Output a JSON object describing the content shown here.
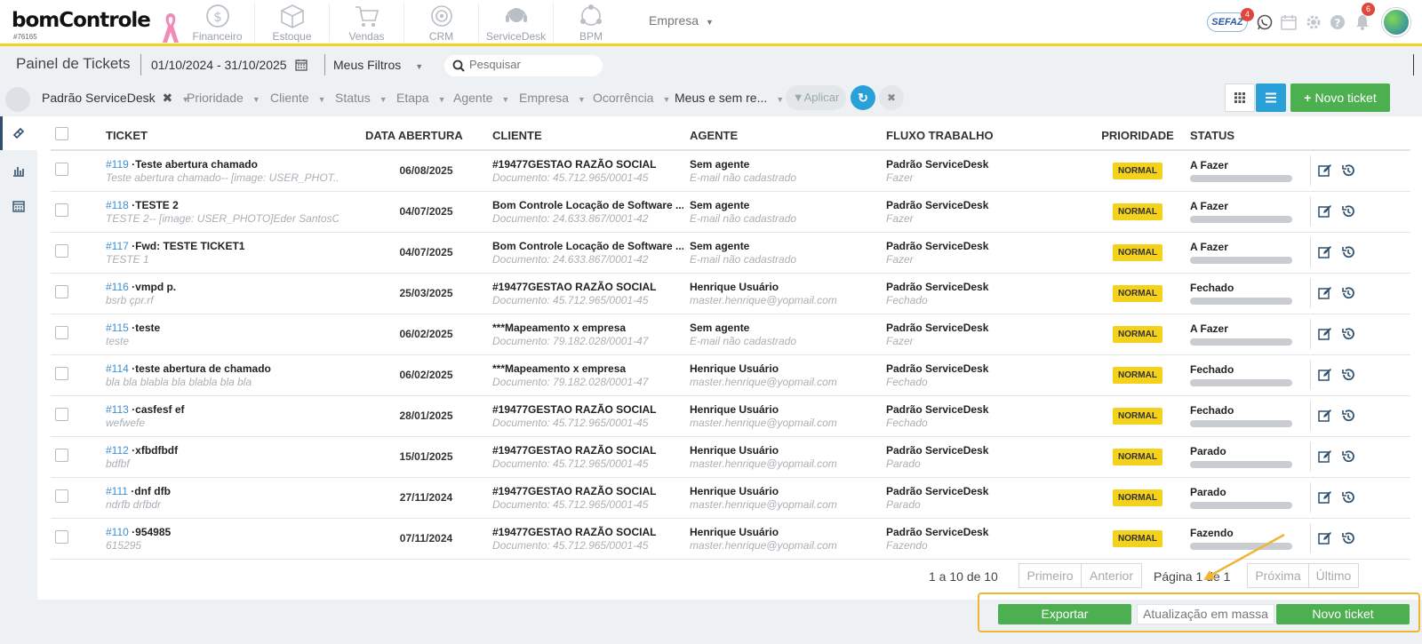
{
  "app": {
    "logo": "bomControle",
    "account_code": "#76165"
  },
  "modules": [
    "Financeiro",
    "Estoque",
    "Vendas",
    "CRM",
    "ServiceDesk",
    "BPM"
  ],
  "company_menu": "Empresa",
  "header_icons": {
    "sefaz": "SEFAZ",
    "sefaz_badge": "4",
    "notif_badge": "6"
  },
  "page": {
    "title": "Painel de Tickets",
    "date_range": "01/10/2024 - 31/10/2025",
    "filters_label": "Meus Filtros",
    "search_placeholder": "Pesquisar"
  },
  "filters": {
    "workflow": "Padrão ServiceDesk",
    "prioridade": "Prioridade",
    "cliente": "Cliente",
    "status": "Status",
    "etapa": "Etapa",
    "agente": "Agente",
    "empresa": "Empresa",
    "ocorrencia": "Ocorrência",
    "scope": "Meus e sem re...",
    "apply": "Aplicar",
    "new_ticket": "Novo ticket"
  },
  "table": {
    "headers": [
      "TICKET",
      "DATA ABERTURA",
      "CLIENTE",
      "AGENTE",
      "FLUXO TRABALHO",
      "PRIORIDADE",
      "STATUS"
    ],
    "rows": [
      {
        "num": "#119",
        "title": " ·Teste abertura chamado",
        "desc": "Teste abertura chamado-- [image: USER_PHOT...",
        "date": "06/08/2025",
        "client": "#19477GESTAO RAZÃO SOCIAL",
        "doc": "Documento: 45.712.965/0001-45",
        "agent": "Sem agente",
        "agent_sub": "E-mail não cadastrado",
        "flow": "Padrão ServiceDesk",
        "stage": "Fazer",
        "priority": "NORMAL",
        "status": "A Fazer"
      },
      {
        "num": "#118",
        "title": " ·TESTE 2",
        "desc": "TESTE 2-- [image: USER_PHOTO]Eder SantosCo...",
        "date": "04/07/2025",
        "client": "Bom Controle Locação de Software ...",
        "doc": "Documento: 24.633.867/0001-42",
        "agent": "Sem agente",
        "agent_sub": "E-mail não cadastrado",
        "flow": "Padrão ServiceDesk",
        "stage": "Fazer",
        "priority": "NORMAL",
        "status": "A Fazer"
      },
      {
        "num": "#117",
        "title": " ·Fwd: TESTE TICKET1",
        "desc": "TESTE 1",
        "date": "04/07/2025",
        "client": "Bom Controle Locação de Software ...",
        "doc": "Documento: 24.633.867/0001-42",
        "agent": "Sem agente",
        "agent_sub": "E-mail não cadastrado",
        "flow": "Padrão ServiceDesk",
        "stage": "Fazer",
        "priority": "NORMAL",
        "status": "A Fazer"
      },
      {
        "num": "#116",
        "title": " ·vmpd p.",
        "desc": "bsrb çpr.rf",
        "date": "25/03/2025",
        "client": "#19477GESTAO RAZÃO SOCIAL",
        "doc": "Documento: 45.712.965/0001-45",
        "agent": "Henrique Usuário",
        "agent_sub": "master.henrique@yopmail.com",
        "flow": "Padrão ServiceDesk",
        "stage": "Fechado",
        "priority": "NORMAL",
        "status": "Fechado"
      },
      {
        "num": "#115",
        "title": " ·teste",
        "desc": "teste",
        "date": "06/02/2025",
        "client": "***Mapeamento x empresa",
        "doc": "Documento: 79.182.028/0001-47",
        "agent": "Sem agente",
        "agent_sub": "E-mail não cadastrado",
        "flow": "Padrão ServiceDesk",
        "stage": "Fazer",
        "priority": "NORMAL",
        "status": "A Fazer"
      },
      {
        "num": "#114",
        "title": " ·teste abertura de chamado",
        "desc": "bla bla blabla bla blabla bla bla",
        "date": "06/02/2025",
        "client": "***Mapeamento x empresa",
        "doc": "Documento: 79.182.028/0001-47",
        "agent": "Henrique Usuário",
        "agent_sub": "master.henrique@yopmail.com",
        "flow": "Padrão ServiceDesk",
        "stage": "Fechado",
        "priority": "NORMAL",
        "status": "Fechado"
      },
      {
        "num": "#113",
        "title": " ·casfesf ef",
        "desc": "wefwefe",
        "date": "28/01/2025",
        "client": "#19477GESTAO RAZÃO SOCIAL",
        "doc": "Documento: 45.712.965/0001-45",
        "agent": "Henrique Usuário",
        "agent_sub": "master.henrique@yopmail.com",
        "flow": "Padrão ServiceDesk",
        "stage": "Fechado",
        "priority": "NORMAL",
        "status": "Fechado"
      },
      {
        "num": "#112",
        "title": " ·xfbdfbdf",
        "desc": "bdfbf",
        "date": "15/01/2025",
        "client": "#19477GESTAO RAZÃO SOCIAL",
        "doc": "Documento: 45.712.965/0001-45",
        "agent": "Henrique Usuário",
        "agent_sub": "master.henrique@yopmail.com",
        "flow": "Padrão ServiceDesk",
        "stage": "Parado",
        "priority": "NORMAL",
        "status": "Parado"
      },
      {
        "num": "#111",
        "title": " ·dnf dfb",
        "desc": "ndrfb drfbdr",
        "date": "27/11/2024",
        "client": "#19477GESTAO RAZÃO SOCIAL",
        "doc": "Documento: 45.712.965/0001-45",
        "agent": "Henrique Usuário",
        "agent_sub": "master.henrique@yopmail.com",
        "flow": "Padrão ServiceDesk",
        "stage": "Parado",
        "priority": "NORMAL",
        "status": "Parado"
      },
      {
        "num": "#110",
        "title": " ·954985",
        "desc": "615295",
        "date": "07/11/2024",
        "client": "#19477GESTAO RAZÃO SOCIAL",
        "doc": "Documento: 45.712.965/0001-45",
        "agent": "Henrique Usuário",
        "agent_sub": "master.henrique@yopmail.com",
        "flow": "Padrão ServiceDesk",
        "stage": "Fazendo",
        "priority": "NORMAL",
        "status": "Fazendo"
      }
    ]
  },
  "pagination": {
    "summary": "1 a 10 de 10",
    "first": "Primeiro",
    "prev": "Anterior",
    "page": "Página 1 de 1",
    "next": "Próxima",
    "last": "Último"
  },
  "footer": {
    "export": "Exportar",
    "bulk_update": "Atualização em massa",
    "new_ticket": "Novo ticket"
  },
  "colors": {
    "accent_yellow": "#f4d11a",
    "primary_green": "#4caf50",
    "link_blue": "#3b8ed4",
    "highlight_orange": "#f0b533"
  }
}
